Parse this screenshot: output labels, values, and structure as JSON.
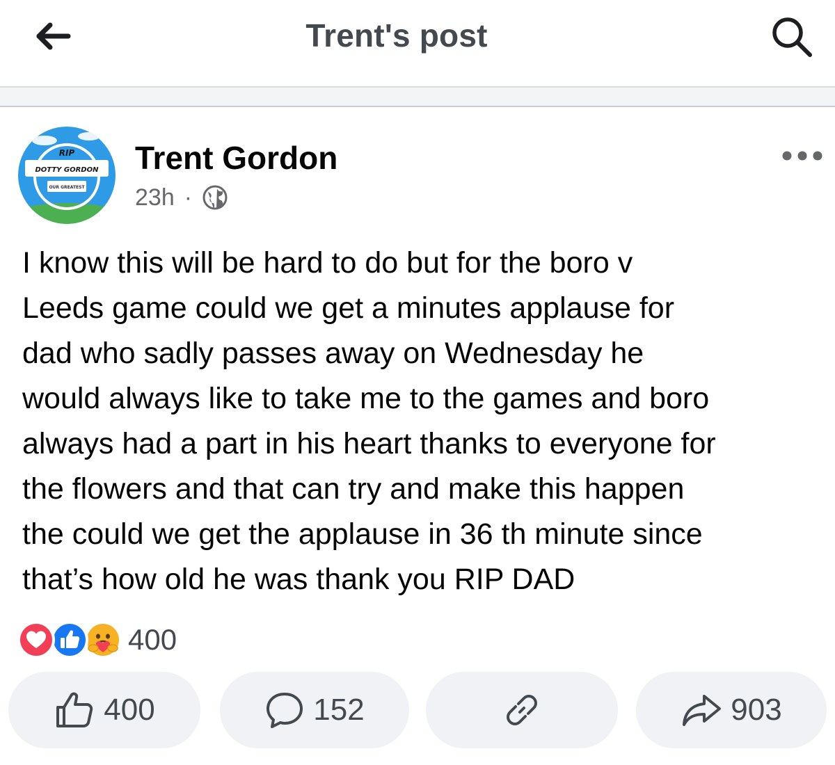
{
  "header": {
    "title": "Trent's post",
    "back_icon": "arrow-left-icon",
    "search_icon": "search-icon"
  },
  "post": {
    "author": "Trent Gordon",
    "avatar": {
      "line1": "RIP",
      "line2": "DOTTY GORDON",
      "line3": "OUR GREATEST",
      "colors": {
        "sky": "#2f9be6",
        "ring": "#1e88e5",
        "ground": "#4caf50"
      }
    },
    "time": "23h",
    "separator": "·",
    "audience_icon": "globe-icon",
    "more_icon": "more-horizontal-icon",
    "text": "I know this will be hard to do but for the boro v\nLeeds game could we get a minutes applause for\ndad who sadly passes away on Wednesday he\nwould always like to take me to the games and boro\nalways had a part in his heart thanks to everyone for\nthe flowers and that can try and make this happen\nthe could we get the applause in 36 th minute since\nthat’s how old he was thank you RIP DAD"
  },
  "reactions": {
    "types": [
      "love",
      "like",
      "care"
    ],
    "count": "400",
    "colors": {
      "love": "#f33e58",
      "like": "#1877f2",
      "care": "#f7b125"
    }
  },
  "actions": {
    "like": {
      "icon": "thumbs-up-icon",
      "count": "400"
    },
    "comment": {
      "icon": "comment-icon",
      "count": "152"
    },
    "link": {
      "icon": "link-icon"
    },
    "share": {
      "icon": "share-icon",
      "count": "903"
    }
  }
}
